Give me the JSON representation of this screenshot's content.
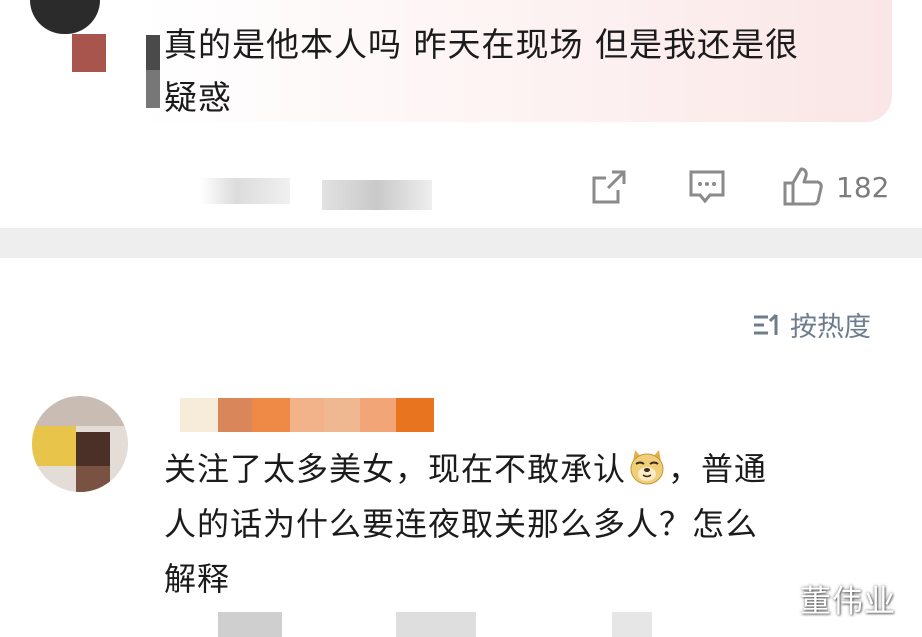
{
  "top_post": {
    "text_line1": "真的是他本人吗 昨天在现场 但是我还是很",
    "text_line2": "疑惑",
    "like_count": "182",
    "icons": [
      "share-icon",
      "comment-icon",
      "thumbs-up-icon"
    ]
  },
  "sort": {
    "icon": "sort-icon",
    "label": "按热度"
  },
  "comment": {
    "text_part1": "关注了太多美女，现在不敢承认",
    "emoji": "doge-emoji",
    "text_part2": "，普通",
    "text_line2": "人的话为什么要连夜取关那么多人？怎么",
    "text_line3": "解释"
  },
  "watermark": "董伟业",
  "colors": {
    "accent_gray": "#8a8a8a",
    "sort_blue_gray": "#6e7d8e",
    "divider": "#eeeeee",
    "post_bg_pink": "#fae6e6"
  }
}
